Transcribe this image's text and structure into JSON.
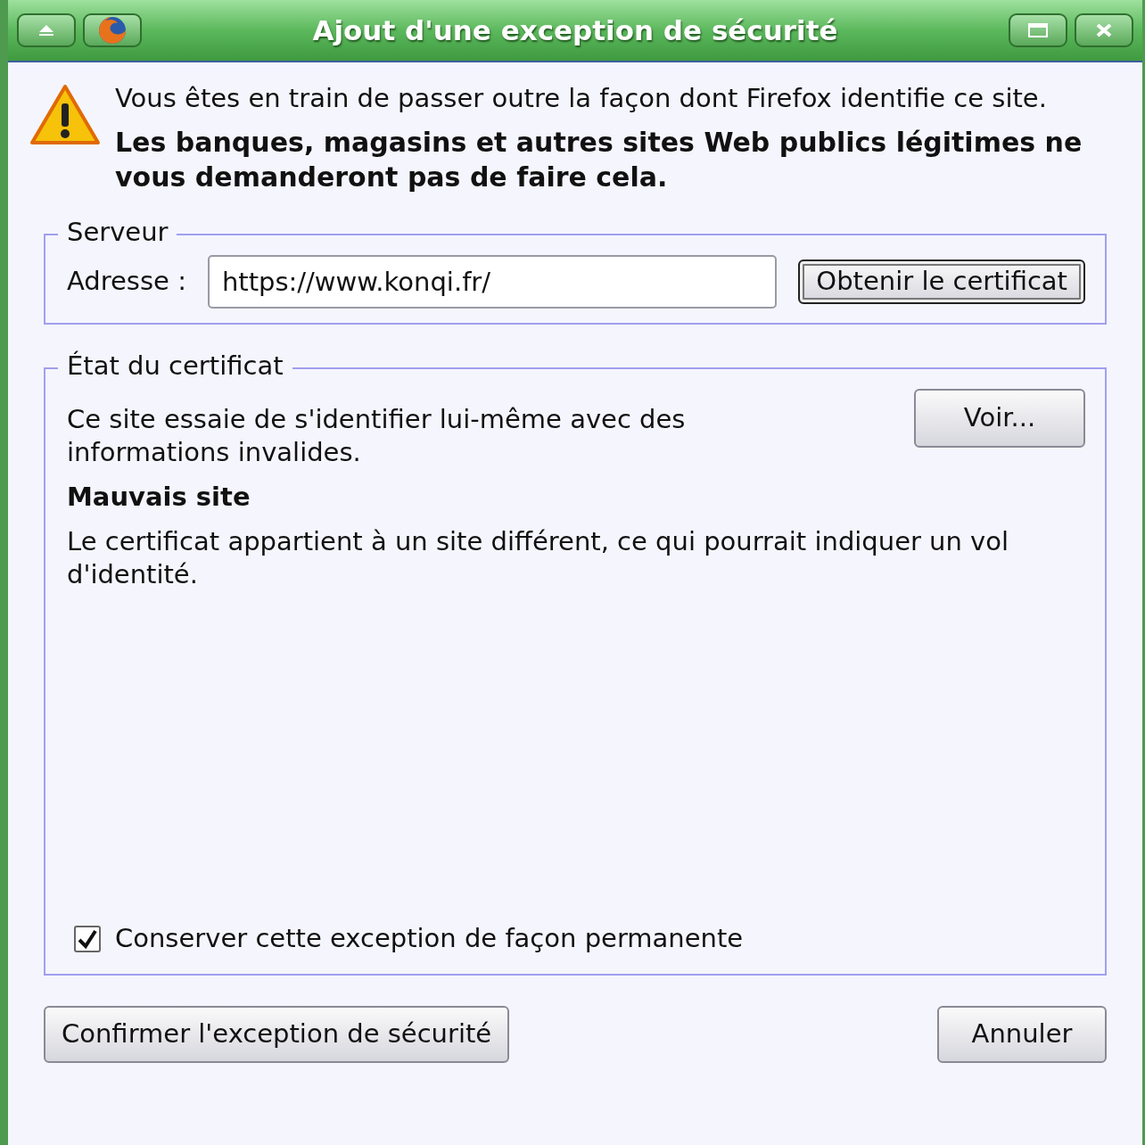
{
  "window": {
    "title": "Ajout d'une exception de sécurité"
  },
  "warning": {
    "text": "Vous êtes en train de passer outre la façon dont Firefox identifie ce site.",
    "emphasis": "Les banques, magasins et autres sites Web publics légitimes ne vous demanderont pas de faire cela."
  },
  "server": {
    "legend": "Serveur",
    "address_label": "Adresse :",
    "address_value": "https://www.konqi.fr/",
    "button": "Obtenir le certificat"
  },
  "certificate_status": {
    "legend": "État du certificat",
    "description": "Ce site essaie de s'identifier lui-même avec des informations invalides.",
    "view_button": "Voir...",
    "problem_title": "Mauvais site",
    "problem_text": "Le certificat appartient à un site différent, ce qui pourrait indiquer un vol d'identité.",
    "permanent": {
      "label": "Conserver cette exception de façon permanente",
      "checked": true
    }
  },
  "buttons": [
    {
      "label": "Confirmer l'exception de sécurité",
      "kind": "confirm"
    },
    {
      "label": "Annuler",
      "kind": "cancel"
    }
  ]
}
